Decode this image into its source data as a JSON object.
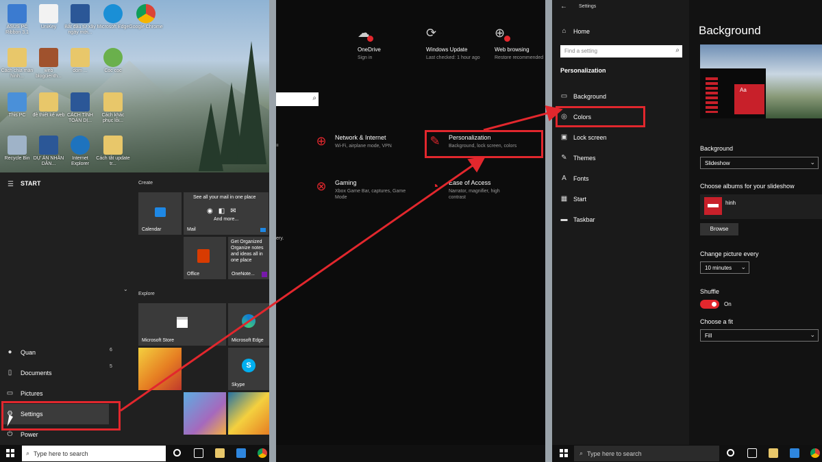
{
  "start_panel": {
    "desktop_icons": [
      "ASUS PC Ribbon 3.1",
      "UniKey",
      "Bắt đầu từ xây ngày mới...",
      "Microsoft Edge",
      "Google Chrome",
      "Cách chia màn hình...",
      "web blogcienth...",
      "dom ...",
      "Coc coc",
      "This PC",
      "đề thiết kế web",
      "CÁCH TÍNH TOÁN DỊ...",
      "Cách khác phục lỗi...",
      "Recycle Bin",
      "DỰ ÁN NHÂN DÂN...",
      "Internet Explorer",
      "Cách tắt update tr..."
    ],
    "start_title": "START",
    "nav": [
      {
        "label": "Quan",
        "icon": "user-icon"
      },
      {
        "label": "Documents",
        "icon": "document-icon"
      },
      {
        "label": "Pictures",
        "icon": "pictures-icon"
      },
      {
        "label": "Settings",
        "icon": "gear-icon"
      },
      {
        "label": "Power",
        "icon": "power-icon"
      }
    ],
    "side_numbers": [
      "6",
      "5"
    ],
    "section_create": "Create",
    "section_explore": "Explore",
    "tiles": {
      "calendar": "Calendar",
      "mail_top": "See all your mail in one place",
      "mail_more": "And more...",
      "mail": "Mail",
      "office": "Office",
      "onenote_text": "Get Organized Organize notes and ideas all in one place",
      "onenote": "OneNote...",
      "store": "Microsoft Store",
      "edge": "Microsoft Edge",
      "skype": "Skype"
    },
    "search_placeholder": "Type here to search"
  },
  "home_panel": {
    "cards": [
      {
        "title": "OneDrive",
        "sub": "Sign in"
      },
      {
        "title": "Windows Update",
        "sub": "Last checked: 1 hour ago"
      },
      {
        "title": "Web browsing",
        "sub": "Restore recommended"
      }
    ],
    "categories": [
      {
        "title": "Network & Internet",
        "sub": "Wi-Fi, airplane mode, VPN"
      },
      {
        "title": "Personalization",
        "sub": "Background, lock screen, colors"
      },
      {
        "title": "Gaming",
        "sub": "Xbox Game Bar, captures, Game Mode"
      },
      {
        "title": "Ease of Access",
        "sub": "Narrator, magnifier, high contrast"
      }
    ],
    "edge_text": "ery."
  },
  "personalization_panel": {
    "window_title": "Settings",
    "home": "Home",
    "find_placeholder": "Find a setting",
    "section": "Personalization",
    "nav": [
      {
        "label": "Background",
        "icon": "image-icon"
      },
      {
        "label": "Colors",
        "icon": "palette-icon"
      },
      {
        "label": "Lock screen",
        "icon": "lock-screen-icon"
      },
      {
        "label": "Themes",
        "icon": "themes-icon"
      },
      {
        "label": "Fonts",
        "icon": "fonts-icon"
      },
      {
        "label": "Start",
        "icon": "start-icon"
      },
      {
        "label": "Taskbar",
        "icon": "taskbar-icon"
      }
    ],
    "page_title": "Background",
    "preview_aa": "Aa",
    "background_label": "Background",
    "background_value": "Slideshow",
    "albums_label": "Choose albums for your slideshow",
    "album_name": "hinh",
    "browse": "Browse",
    "change_label": "Change picture every",
    "change_value": "10 minutes",
    "shuffle_label": "Shuffle",
    "shuffle_state": "On",
    "fit_label": "Choose a fit",
    "fit_value": "Fill",
    "search_placeholder": "Type here to search"
  },
  "colors": {
    "accent": "#e2272d",
    "dark": "#0c0c0c"
  }
}
